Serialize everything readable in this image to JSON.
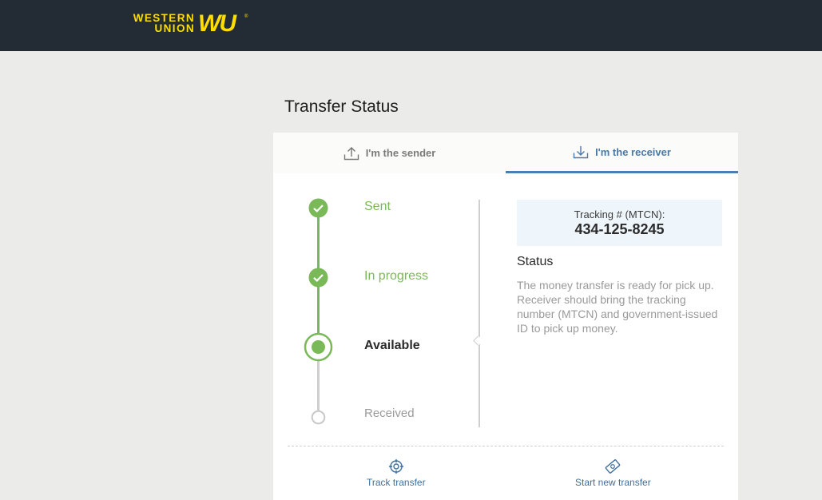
{
  "header": {
    "logo_line1": "WESTERN",
    "logo_line2": "UNION",
    "logo_mark": "WU"
  },
  "page": {
    "title": "Transfer Status"
  },
  "tabs": [
    {
      "label": "I'm the sender",
      "icon": "upload-icon",
      "selected": false
    },
    {
      "label": "I'm the receiver",
      "icon": "download-icon",
      "selected": true
    }
  ],
  "steps": [
    {
      "label": "Sent",
      "state": "done"
    },
    {
      "label": "In progress",
      "state": "done"
    },
    {
      "label": "Available",
      "state": "current"
    },
    {
      "label": "Received",
      "state": "pending"
    }
  ],
  "tracking": {
    "label": "Tracking # (MTCN):",
    "number": "434-125-8245"
  },
  "status": {
    "heading": "Status",
    "text": "The money transfer is ready for pick up. Receiver should bring the tracking number (MTCN) and government-issued ID to pick up money."
  },
  "actions": {
    "track": {
      "label": "Track transfer",
      "icon": "target-icon"
    },
    "new": {
      "label": "Start new transfer",
      "icon": "money-icon"
    }
  },
  "colors": {
    "header_bg": "#232c35",
    "brand_yellow": "#ffdd00",
    "step_green": "#7ab958",
    "accent_blue": "#4a7fae"
  }
}
